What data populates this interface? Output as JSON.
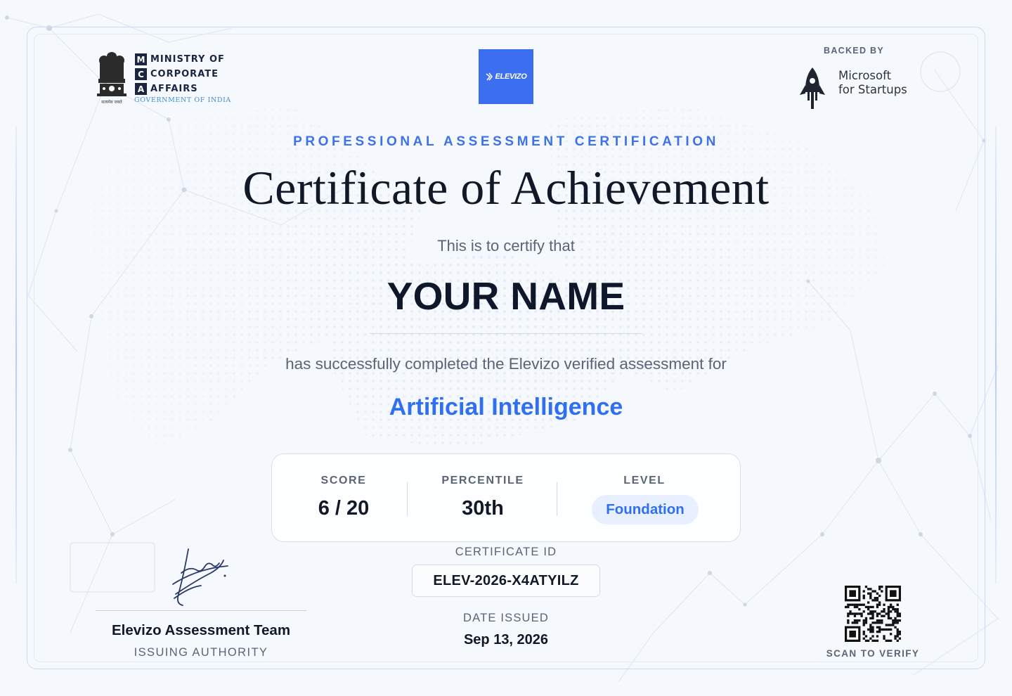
{
  "issuer_logo": {
    "letters": [
      "M",
      "C",
      "A"
    ],
    "words": [
      "MINISTRY OF",
      "CORPORATE",
      "AFFAIRS"
    ],
    "subtext": "GOVERNMENT OF INDIA",
    "emblem_caption": "सत्यमेव जयते"
  },
  "brand_logo": {
    "text": "ELEVIZO",
    "bg_color": "#3b6ff0"
  },
  "backing": {
    "label": "BACKED BY",
    "partner_line1": "Microsoft",
    "partner_line2": "for Startups"
  },
  "certificate": {
    "subtitle": "PROFESSIONAL ASSESSMENT CERTIFICATION",
    "title": "Certificate of Achievement",
    "certify_text": "This is to certify that",
    "recipient_name": "YOUR NAME",
    "completion_text": "has successfully completed the Elevizo verified assessment for",
    "subject": "Artificial Intelligence",
    "accent_color": "#2f6ff0"
  },
  "stats": {
    "score_label": "SCORE",
    "score_value": "6 / 20",
    "percentile_label": "PERCENTILE",
    "percentile_value": "30th",
    "level_label": "LEVEL",
    "level_value": "Foundation"
  },
  "meta": {
    "certificate_id_label": "CERTIFICATE ID",
    "certificate_id": "ELEV-2026-X4ATYILZ",
    "date_label": "DATE ISSUED",
    "date_value": "Sep 13, 2026"
  },
  "signatory": {
    "name": "Elevizo Assessment Team",
    "role": "ISSUING AUTHORITY"
  },
  "verify": {
    "label": "SCAN TO VERIFY"
  }
}
